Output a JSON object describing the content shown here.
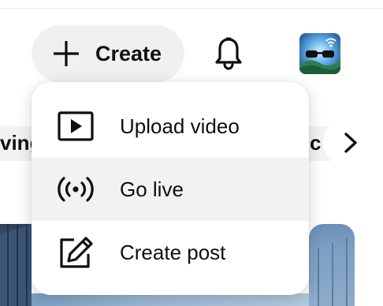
{
  "header": {
    "create_label": "Create",
    "icons": {
      "create": "plus-icon",
      "notifications": "bell-icon",
      "avatar": "avatar"
    }
  },
  "chips": {
    "left_partial": "ving",
    "right_partial": "c",
    "next_icon": "chevron-right-icon"
  },
  "create_menu": {
    "items": [
      {
        "label": "Upload video",
        "icon": "upload-video-icon",
        "highlighted": false
      },
      {
        "label": "Go live",
        "icon": "live-broadcast-icon",
        "highlighted": true
      },
      {
        "label": "Create post",
        "icon": "edit-post-icon",
        "highlighted": false
      }
    ]
  },
  "colors": {
    "text": "#0f0f0f",
    "button_bg": "#f0f0f0",
    "menu_bg": "#ffffff",
    "highlight_bg": "#f2f2f2"
  }
}
